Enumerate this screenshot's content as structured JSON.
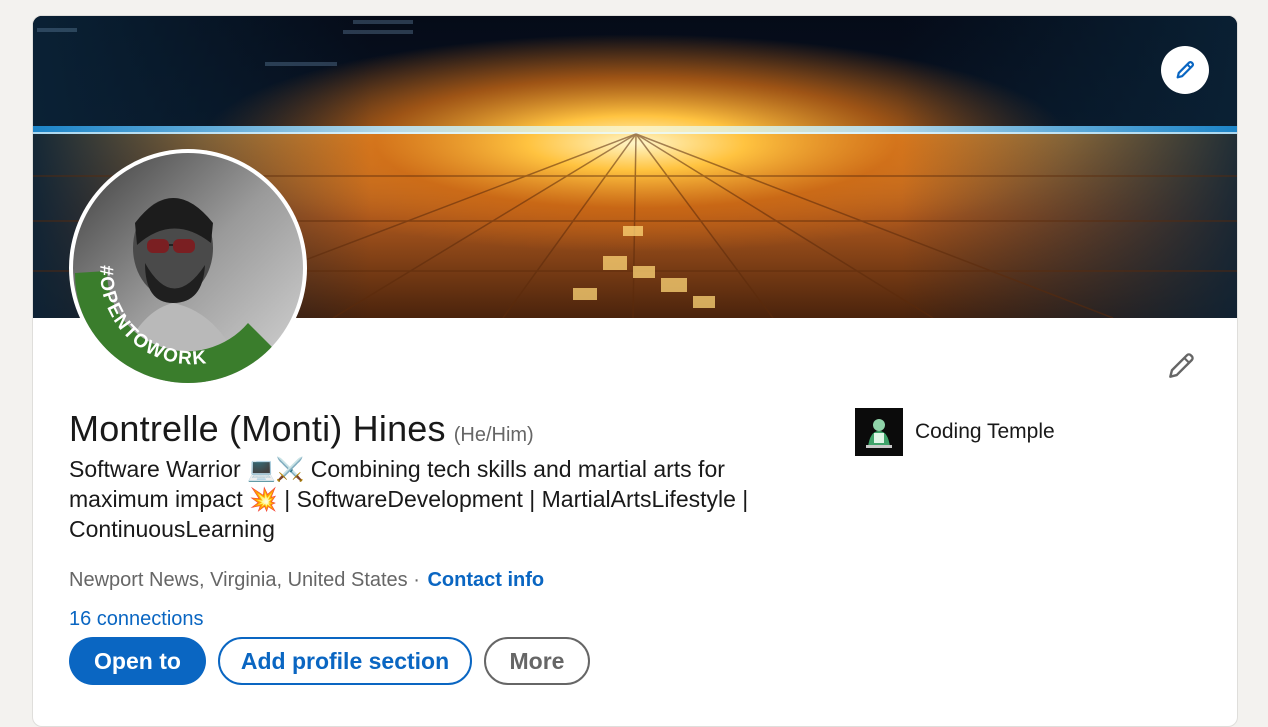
{
  "profile": {
    "name": "Montrelle (Monti) Hines",
    "pronouns": "(He/Him)",
    "headline": "Software Warrior 💻⚔️ Combining tech skills and martial arts for maximum impact 💥 | SoftwareDevelopment | MartialArtsLifestyle | ContinuousLearning",
    "location": "Newport News, Virginia, United States",
    "separator": "·",
    "contact_label": "Contact info",
    "connections": "16 connections",
    "open_to_work_badge": "#OPENTOWORK"
  },
  "company": {
    "name": "Coding Temple"
  },
  "actions": {
    "open_to_label": "Open to",
    "add_section_label": "Add profile section",
    "more_label": "More"
  },
  "icons": {
    "banner_edit": "pencil-icon",
    "intro_edit": "pencil-icon"
  },
  "colors": {
    "accent": "#0a66c2",
    "open_to_work_ring": "#3a7d2c",
    "text_primary": "#191919",
    "text_secondary": "#666666",
    "page_background": "#f3f2ef"
  }
}
